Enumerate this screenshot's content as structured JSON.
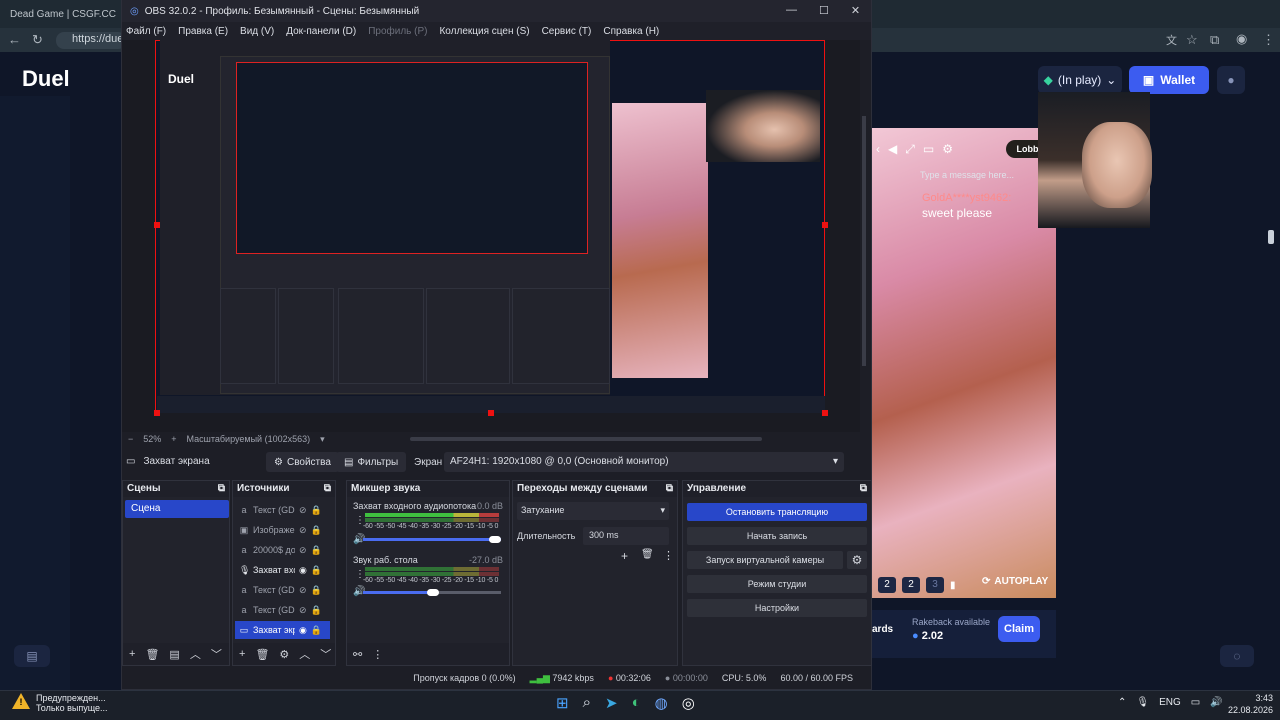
{
  "browser": {
    "tab_title": "Dead Game | CSGF.CC",
    "url": "https://duel"
  },
  "site": {
    "logo": "Duel",
    "inplay": "(In play)",
    "wallet": "Wallet",
    "lobby": "Lobby",
    "chat_placeholder": "Type a message here...",
    "chat_user": "GoldA****yst9462:",
    "chat_msg": "sweet please",
    "bet": [
      "2",
      "2",
      "3"
    ],
    "autoplay": "AUTOPLAY",
    "rake_label": "Rakeback available",
    "rake_value": "2.02",
    "claim": "Claim",
    "cards": "ards"
  },
  "obs": {
    "title": "OBS 32.0.2 - Профиль: Безымянный - Сцены: Безымянный",
    "menu": [
      {
        "label": "Файл (F)"
      },
      {
        "label": "Правка (E)"
      },
      {
        "label": "Вид (V)"
      },
      {
        "label": "Док-панели (D)"
      },
      {
        "label": "Профиль (P)",
        "dim": true
      },
      {
        "label": "Коллекция сцен (S)"
      },
      {
        "label": "Сервис (T)"
      },
      {
        "label": "Справка (H)"
      }
    ],
    "zoom": "52%",
    "scale_mode": "Масштабируемый (1002x563)",
    "source_name": "Захват экрана",
    "properties": "Свойства",
    "filters": "Фильтры",
    "screen_label": "Экран",
    "screen_value": "AF24H1: 1920x1080 @ 0,0 (Основной монитор)",
    "scenes_title": "Сцены",
    "scene": "Сцена",
    "sources_title": "Источники",
    "sources": [
      "Текст (GDI",
      "Изображе",
      "20000$ до",
      "Захват вхо",
      "Текст (GDI",
      "Текст (GDI",
      "Захват экр"
    ],
    "mixer_title": "Микшер звука",
    "mixer": [
      {
        "name": "Захват входного аудиопотока",
        "db": "0.0 dB",
        "level": 0.72,
        "volume": 1.0
      },
      {
        "name": "Звук раб. стола",
        "db": "-27.0 dB",
        "level": 0.55,
        "volume": 0.5
      }
    ],
    "scale_ticks": "-60 -55 -50 -45 -40 -35 -30 -25 -20 -15 -10 -5 0",
    "transitions_title": "Переходы между сценами",
    "transition": "Затухание",
    "duration_label": "Длительность",
    "duration": "300 ms",
    "controls_title": "Управление",
    "controls": [
      "Остановить трансляцию",
      "Начать запись",
      "Запуск виртуальной камеры",
      "Режим студии",
      "Настройки"
    ],
    "status": {
      "dropped": "Пропуск кадров 0 (0.0%)",
      "kbps": "7942 kbps",
      "stream_time": "00:32:06",
      "rec_time": "00:00:00",
      "cpu": "CPU: 5.0%",
      "fps": "60.00 / 60.00 FPS"
    }
  },
  "taskbar": {
    "warn_title": "Предупрежден...",
    "warn_sub": "Только выпуще...",
    "lang": "ENG",
    "time": "3:43",
    "date": "22.08.2026"
  },
  "colors": {
    "accent": "#3c5cf0",
    "obs_selected": "#2847c9",
    "record_border": "#e11111"
  }
}
